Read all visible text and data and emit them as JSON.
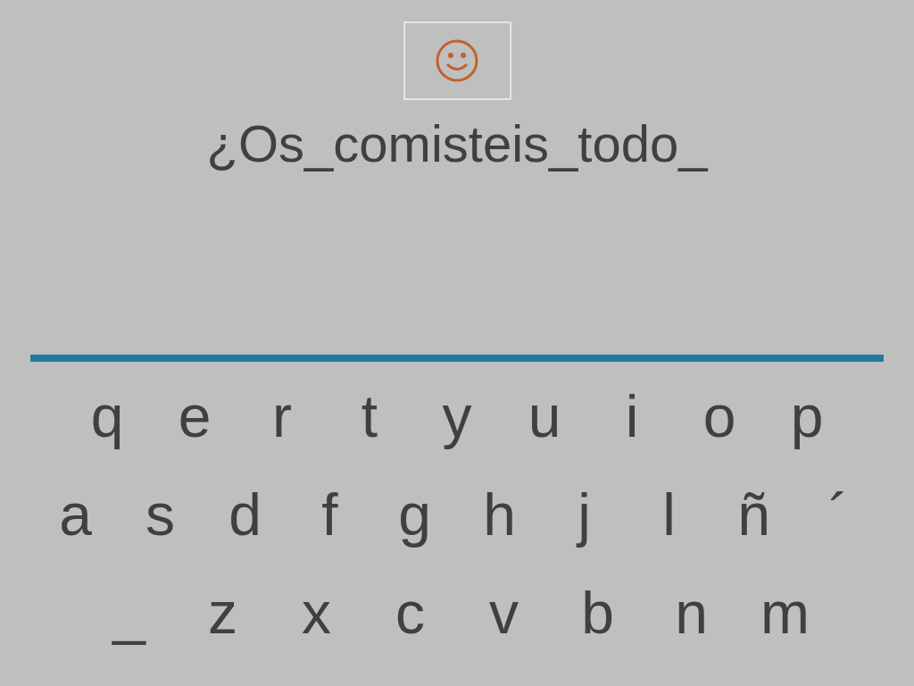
{
  "prompt": "¿Os_comisteis_todo_",
  "keyboard": {
    "rows": [
      {
        "keys": [
          "q",
          "e",
          "r",
          "t",
          "y",
          "u",
          "i",
          "o",
          "p"
        ]
      },
      {
        "keys": [
          "a",
          "s",
          "d",
          "f",
          "g",
          "h",
          "j",
          "l",
          "ñ",
          "´"
        ]
      },
      {
        "keys": [
          "_",
          "z",
          "x",
          "c",
          "v",
          "b",
          "n",
          "m"
        ]
      }
    ]
  }
}
